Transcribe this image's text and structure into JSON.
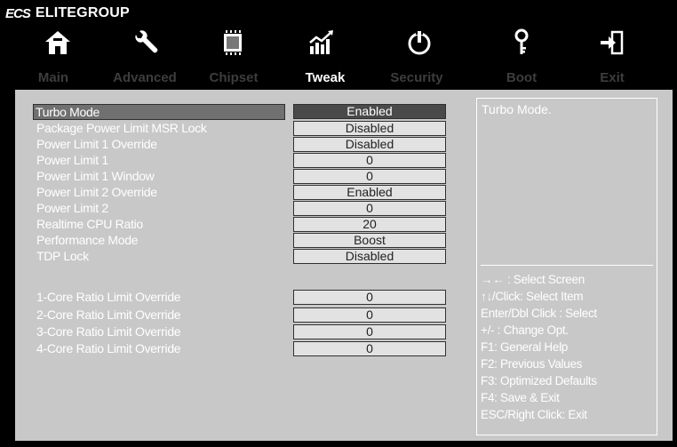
{
  "brand": {
    "logo": "ECS",
    "name": "ELITEGROUP"
  },
  "tabs": [
    {
      "label": "Main",
      "icon": "home-icon",
      "active": false
    },
    {
      "label": "Advanced",
      "icon": "wrench-icon",
      "active": false
    },
    {
      "label": "Chipset",
      "icon": "chip-icon",
      "active": false
    },
    {
      "label": "Tweak",
      "icon": "chart-icon",
      "active": true
    },
    {
      "label": "Security",
      "icon": "power-icon",
      "active": false
    },
    {
      "label": "Boot",
      "icon": "key-icon",
      "active": false
    },
    {
      "label": "Exit",
      "icon": "exit-icon",
      "active": false
    }
  ],
  "settings": [
    {
      "label": "Turbo Mode",
      "value": "Enabled",
      "selected": true
    },
    {
      "label": "Package Power Limit MSR Lock",
      "value": "Disabled"
    },
    {
      "label": "Power Limit 1 Override",
      "value": "Disabled"
    },
    {
      "label": "Power Limit 1",
      "value": "0"
    },
    {
      "label": "Power Limit 1 Window",
      "value": "0"
    },
    {
      "label": "Power Limit 2 Override",
      "value": "Enabled"
    },
    {
      "label": "Power Limit 2",
      "value": "0"
    },
    {
      "label": "Realtime CPU Ratio",
      "value": "20"
    },
    {
      "label": "Performance Mode",
      "value": "Boost"
    },
    {
      "label": "TDP Lock",
      "value": "Disabled"
    }
  ],
  "core_ratios": [
    {
      "label": "1-Core Ratio Limit Override",
      "value": "0"
    },
    {
      "label": "2-Core Ratio Limit Override",
      "value": "0"
    },
    {
      "label": "3-Core Ratio Limit Override",
      "value": "0"
    },
    {
      "label": "4-Core Ratio Limit Override",
      "value": "0"
    }
  ],
  "help": {
    "description": "Turbo Mode.",
    "keys": [
      "→← : Select Screen",
      "↑↓/Click: Select Item",
      "Enter/Dbl Click : Select",
      "+/- : Change Opt.",
      "F1: General Help",
      "F2: Previous Values",
      "F3: Optimized Defaults",
      "F4: Save & Exit",
      "ESC/Right Click: Exit"
    ]
  },
  "colors": {
    "background": "#000000",
    "panel": "#c8c8c8",
    "value_box": "#e2e2e2",
    "selected_value": "#4a4a4a",
    "text": "#ffffff",
    "inactive_tab": "#3d3d3d"
  }
}
